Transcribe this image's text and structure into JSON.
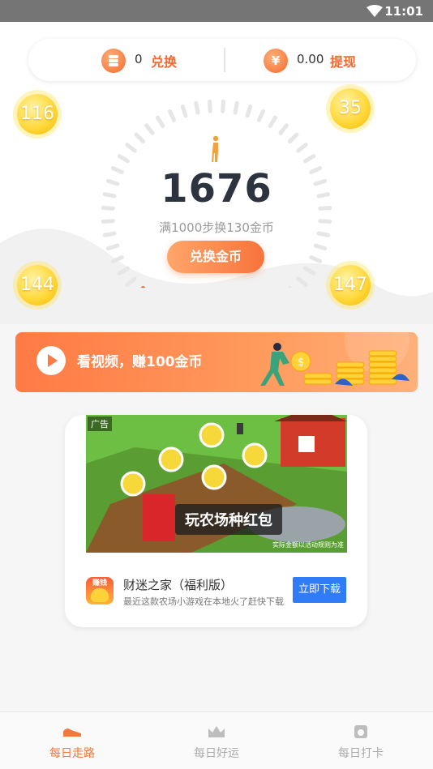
{
  "status_bar": {
    "time": "11:01"
  },
  "balance": {
    "coins": "0",
    "coin_action": "兑换",
    "coin_icon": "coin-stack-icon",
    "cash": "0.00",
    "cash_action": "提现",
    "cash_icon": "yen-icon",
    "cash_symbol": "¥"
  },
  "bubbles": [
    "116",
    "35",
    "144",
    "147"
  ],
  "pedometer": {
    "steps": "1676",
    "rule": "满1000步换130金币",
    "button": "兑换金币",
    "progress": 0.0
  },
  "video_banner": {
    "text": "看视频，赚100金币"
  },
  "ad": {
    "tag": "广告",
    "caption": "玩农场种红包",
    "fine_print": "实际金额以活动规则为准",
    "app_icon_label": "赚钱",
    "app_name": "财迷之家（福利版）",
    "app_desc": "最近这款农场小游戏在本地火了赶快下载",
    "download": "立即下载"
  },
  "tabs": [
    {
      "label": "每日走路",
      "icon": "sneaker-icon",
      "active": true
    },
    {
      "label": "每日好运",
      "icon": "crown-icon",
      "active": false
    },
    {
      "label": "每日打卡",
      "icon": "camera-icon",
      "active": false
    }
  ],
  "colors": {
    "accent": "#f26a30",
    "blue": "#2f7cf6",
    "gold": "#ffd93d"
  }
}
